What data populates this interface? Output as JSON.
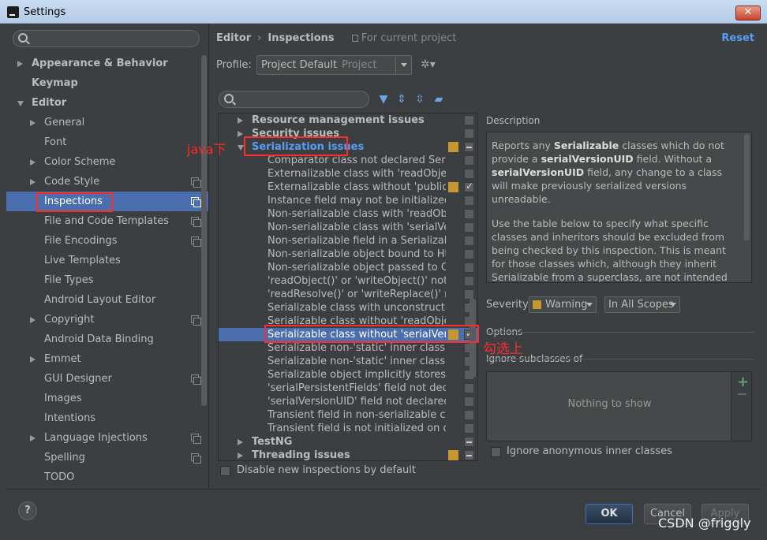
{
  "window": {
    "title": "Settings",
    "close_label": "✕"
  },
  "left": {
    "items": [
      {
        "label": "Appearance & Behavior",
        "indent": 0,
        "expander": "right",
        "bold": true
      },
      {
        "label": "Keymap",
        "indent": 0,
        "expander": "none",
        "bold": true
      },
      {
        "label": "Editor",
        "indent": 0,
        "expander": "down",
        "bold": true
      },
      {
        "label": "General",
        "indent": 1,
        "expander": "right"
      },
      {
        "label": "Font",
        "indent": 1,
        "expander": "none"
      },
      {
        "label": "Color Scheme",
        "indent": 1,
        "expander": "right"
      },
      {
        "label": "Code Style",
        "indent": 1,
        "expander": "right",
        "copy": true
      },
      {
        "label": "Inspections",
        "indent": 1,
        "expander": "none",
        "copy": true,
        "selected": true
      },
      {
        "label": "File and Code Templates",
        "indent": 1,
        "expander": "none",
        "copy": true
      },
      {
        "label": "File Encodings",
        "indent": 1,
        "expander": "none",
        "copy": true
      },
      {
        "label": "Live Templates",
        "indent": 1,
        "expander": "none"
      },
      {
        "label": "File Types",
        "indent": 1,
        "expander": "none"
      },
      {
        "label": "Android Layout Editor",
        "indent": 1,
        "expander": "none"
      },
      {
        "label": "Copyright",
        "indent": 1,
        "expander": "right",
        "copy": true
      },
      {
        "label": "Android Data Binding",
        "indent": 1,
        "expander": "none"
      },
      {
        "label": "Emmet",
        "indent": 1,
        "expander": "right"
      },
      {
        "label": "GUI Designer",
        "indent": 1,
        "expander": "none",
        "copy": true
      },
      {
        "label": "Images",
        "indent": 1,
        "expander": "none"
      },
      {
        "label": "Intentions",
        "indent": 1,
        "expander": "none"
      },
      {
        "label": "Language Injections",
        "indent": 1,
        "expander": "right",
        "copy": true
      },
      {
        "label": "Spelling",
        "indent": 1,
        "expander": "none",
        "copy": true
      },
      {
        "label": "TODO",
        "indent": 1,
        "expander": "none"
      }
    ]
  },
  "header": {
    "crumb1": "Editor",
    "sep": "›",
    "crumb2": "Inspections",
    "project_note": "For current project",
    "reset": "Reset"
  },
  "profile": {
    "label": "Profile:",
    "value": "Project Default",
    "sub": "Project"
  },
  "inspections": {
    "rows": [
      {
        "label": "Resource management issues",
        "group": true,
        "expander": "right",
        "cb": "plain"
      },
      {
        "label": "Security issues",
        "group": true,
        "expander": "right",
        "cb": "plain"
      },
      {
        "label": "Serialization issues",
        "group": true,
        "blue": true,
        "expander": "down",
        "sev": true,
        "cb": "partial"
      },
      {
        "label": "Comparator class not declared Serializable",
        "cb": "plain"
      },
      {
        "label": "Externalizable class with 'readObject()' or 'writeObject()'",
        "cb": "plain"
      },
      {
        "label": "Externalizable class without 'public' no-arg constructor",
        "sev": true,
        "cb": "checked"
      },
      {
        "label": "Instance field may not be initialized by 'readObject()'",
        "cb": "plain"
      },
      {
        "label": "Non-serializable class with 'readObject()' or 'writeObject()'",
        "cb": "plain"
      },
      {
        "label": "Non-serializable class with 'serialVersionUID'",
        "cb": "plain"
      },
      {
        "label": "Non-serializable field in a Serializable class",
        "cb": "plain"
      },
      {
        "label": "Non-serializable object bound to HttpSession",
        "cb": "plain"
      },
      {
        "label": "Non-serializable object passed to ObjectOutputStream",
        "cb": "plain"
      },
      {
        "label": "'readObject()' or 'writeObject()' not declared 'private'",
        "cb": "plain"
      },
      {
        "label": "'readResolve()' or 'writeReplace()' not declared 'protected'",
        "cb": "plain"
      },
      {
        "label": "Serializable class with unconstructable ancestor",
        "cb": "plain"
      },
      {
        "label": "Serializable class without 'readObject()' and 'writeObject()'",
        "cb": "plain"
      },
      {
        "label": "Serializable class without 'serialVersionUID'",
        "sev": true,
        "cb": "checked",
        "selected": true
      },
      {
        "label": "Serializable non-'static' inner class with non-Serializable outer class",
        "cb": "plain"
      },
      {
        "label": "Serializable non-'static' inner class without 'serialVersionUID'",
        "cb": "plain"
      },
      {
        "label": "Serializable object implicitly stores non-Serializable object",
        "cb": "plain"
      },
      {
        "label": "'serialPersistentFields' field not declared 'private static final ObjectStreamField[]'",
        "cb": "plain"
      },
      {
        "label": "'serialVersionUID' field not declared 'private static final long'",
        "cb": "plain"
      },
      {
        "label": "Transient field in non-serializable class",
        "cb": "plain"
      },
      {
        "label": "Transient field is not initialized on deserialization",
        "cb": "plain"
      },
      {
        "label": "TestNG",
        "group": true,
        "expander": "right",
        "cb": "partial"
      },
      {
        "label": "Threading issues",
        "group": true,
        "expander": "right",
        "sev": true,
        "cb": "partial"
      }
    ],
    "disable_label": "Disable new inspections by default"
  },
  "description": {
    "label": "Description",
    "p1_a": "Reports any ",
    "p1_b": "Serializable",
    "p1_c": " classes which do not provide a ",
    "p1_d": "serialVersionUID",
    "p1_e": " field. Without a ",
    "p1_f": "serialVersionUID",
    "p1_g": " field, any change to a class will make previously serialized versions unreadable.",
    "p2": "Use the table below to specify what specific classes and inheritors should be excluded from being checked by this inspection. This is meant for those classes which, although they inherit Serializable from a superclass, are not intended for serialization. Such classes would lead this inspection to report"
  },
  "severity": {
    "label": "Severity:",
    "value": "Warning",
    "color": "#c8962e",
    "scope": "In All Scopes"
  },
  "options": {
    "label": "Options",
    "ignore_sub": "Ignore subclasses of",
    "nothing": "Nothing to show",
    "plus": "+",
    "anon_label": "Ignore anonymous inner classes"
  },
  "buttons": {
    "help": "?",
    "ok": "OK",
    "cancel": "Cancel",
    "apply": "Apply"
  },
  "annotations": {
    "java": "java下",
    "check": "勾选上",
    "watermark": "CSDN @friggly"
  }
}
